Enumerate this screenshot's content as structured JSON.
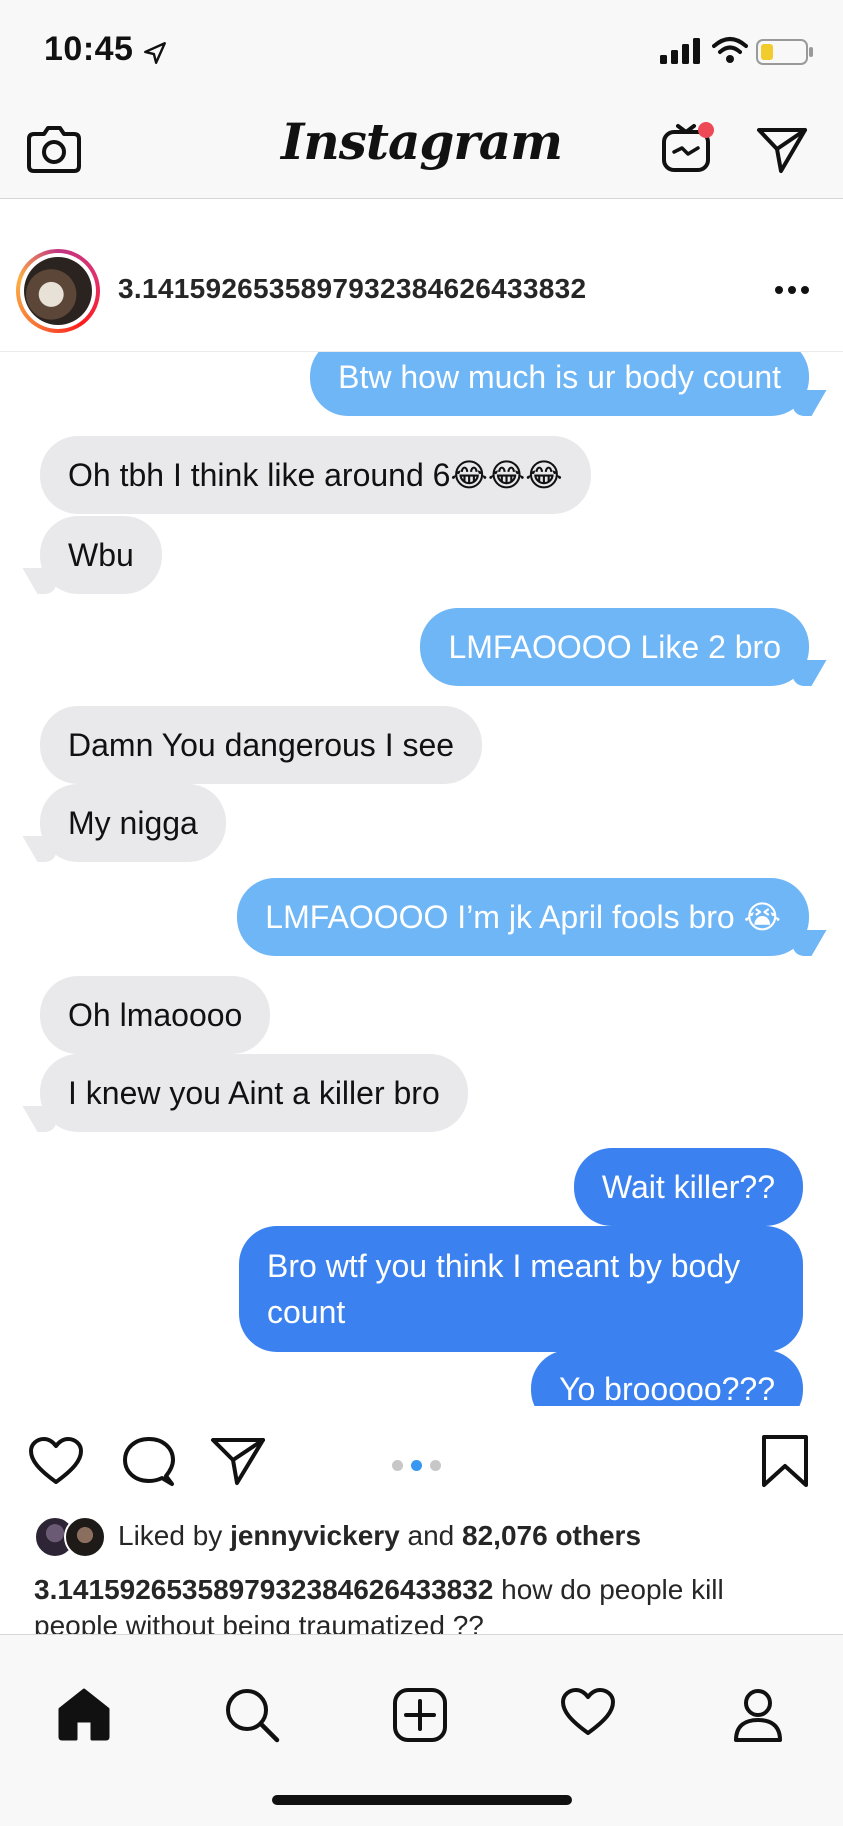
{
  "status_bar": {
    "time": "10:45"
  },
  "header": {
    "brand": "Instagram",
    "icons": [
      "camera-icon",
      "igtv-icon",
      "direct-message-icon"
    ],
    "notification_color": "#ed4956"
  },
  "post": {
    "username": "3.14159265358979323846264338 32",
    "username_display": "3.1415926535897932384626433832",
    "messages": [
      {
        "side": "right",
        "style": "light",
        "text": "Btw how much is ur body count"
      },
      {
        "side": "left",
        "style": "gray",
        "text": "Oh tbh I think like around 6😂😂😂"
      },
      {
        "side": "left",
        "style": "gray",
        "text": "Wbu"
      },
      {
        "side": "right",
        "style": "light",
        "text": "LMFAOOOO Like 2 bro"
      },
      {
        "side": "left",
        "style": "gray",
        "text": "Damn You dangerous I see"
      },
      {
        "side": "left",
        "style": "gray",
        "text": "My nigga"
      },
      {
        "side": "right",
        "style": "light",
        "text": "LMFAOOOO I’m jk April fools bro 😭"
      },
      {
        "side": "left",
        "style": "gray",
        "text": "Oh lmaoooo"
      },
      {
        "side": "left",
        "style": "gray",
        "text": "I knew you Aint a killer bro"
      },
      {
        "side": "right",
        "style": "blue",
        "text": "Wait killer??"
      },
      {
        "side": "right",
        "style": "blue",
        "text": "Bro wtf you think I meant by body count"
      },
      {
        "side": "right",
        "style": "blue",
        "text": "Yo brooooo???"
      }
    ],
    "carousel": {
      "current_page": 2,
      "total_pages": 3
    },
    "likes": {
      "prefix": "Liked by ",
      "first_user": "jennyvickery",
      "middle": " and ",
      "others": "82,076 others"
    },
    "caption": {
      "username": "3.1415926535897932384626433832",
      "text": " how do people kill people without being traumatized ??"
    }
  },
  "tab_bar": {
    "items": [
      "home-icon",
      "search-icon",
      "add-post-icon",
      "activity-heart-icon",
      "profile-icon"
    ]
  },
  "colors": {
    "bubble_gray": "#e9e9eb",
    "bubble_light_blue": "#6fb6f6",
    "bubble_blue": "#3b82f0",
    "carousel_active": "#3897f0"
  }
}
